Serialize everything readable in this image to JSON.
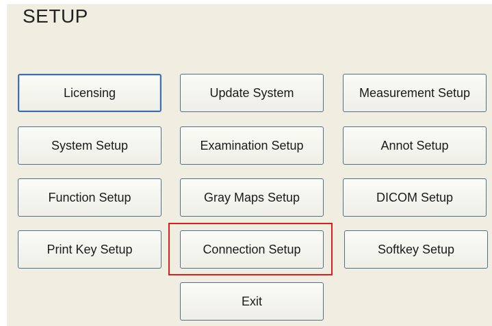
{
  "window": {
    "title": "SETUP"
  },
  "buttons": {
    "licensing": "Licensing",
    "update_system": "Update System",
    "measurement_setup": "Measurement Setup",
    "system_setup": "System Setup",
    "examination_setup": "Examination Setup",
    "annot_setup": "Annot Setup",
    "function_setup": "Function Setup",
    "gray_maps_setup": "Gray Maps Setup",
    "dicom_setup": "DICOM Setup",
    "print_key_setup": "Print Key Setup",
    "connection_setup": "Connection Setup",
    "softkey_setup": "Softkey Setup",
    "exit": "Exit"
  },
  "colors": {
    "panel_background": "#efeee0",
    "button_border": "#4e6f8f",
    "highlight": "#e01b1b"
  }
}
